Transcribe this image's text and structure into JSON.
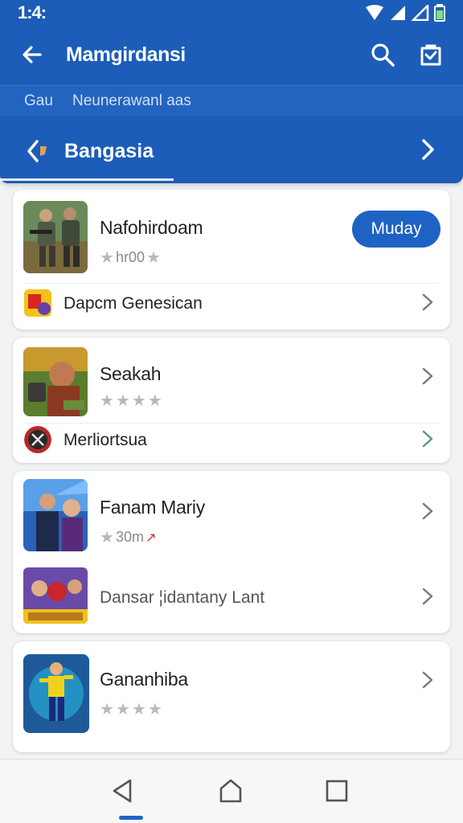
{
  "status_bar": {
    "time": "1:4:"
  },
  "header": {
    "title": "Mamgirdansi",
    "sub_a": "Gau",
    "sub_b": "Neunerawanl aas",
    "nav_title": "Bangasia"
  },
  "cards": [
    {
      "name": "Nafohirdoam",
      "rating_text": "hr00",
      "button_label": "Muday",
      "sub_label": "Dapcm Genesican"
    },
    {
      "name": "Seakah",
      "sub_label": "Merliortsua"
    },
    {
      "name": "Fanam Mariy",
      "rating_text": "30m",
      "sub_label": "Dansar ¦idantany Lant"
    },
    {
      "name": "Gananhiba"
    }
  ],
  "colors": {
    "primary": "#1b5db8",
    "accent_button": "#1e63c4",
    "background": "#f1f3f5"
  },
  "icons": {
    "back": "arrow-left-icon",
    "search": "search-icon",
    "bag": "shopping-bag-icon",
    "chevron": "chevron-right-icon"
  }
}
